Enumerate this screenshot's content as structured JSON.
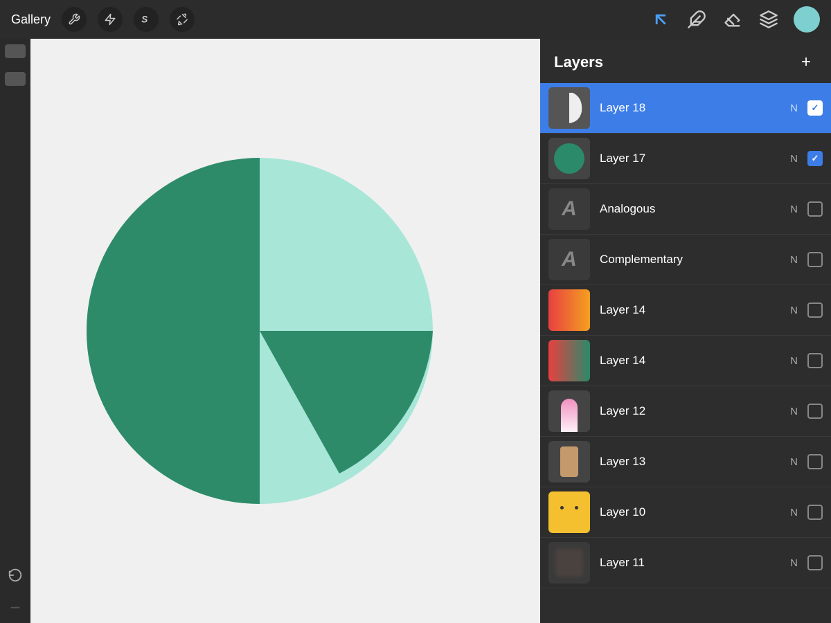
{
  "topbar": {
    "gallery_label": "Gallery",
    "tools": [
      "wrench",
      "lightning",
      "s-curve",
      "send"
    ],
    "right_tools": [
      "pen",
      "nib",
      "eraser",
      "layers"
    ],
    "avatar_color": "#7ecfcf"
  },
  "left_toolbar": {
    "top_buttons": [
      "rect1",
      "rect2"
    ],
    "undo_label": "↩"
  },
  "canvas": {
    "background": "#f0f0f0"
  },
  "layers_panel": {
    "title": "Layers",
    "add_label": "+",
    "layers": [
      {
        "id": 0,
        "name": "Layer 18",
        "mode": "N",
        "checked": true,
        "active": true,
        "thumb": "white-shape"
      },
      {
        "id": 1,
        "name": "Layer 17",
        "mode": "N",
        "checked": true,
        "active": false,
        "thumb": "green-circle"
      },
      {
        "id": 2,
        "name": "Analogous",
        "mode": "N",
        "checked": false,
        "active": false,
        "thumb": "letter"
      },
      {
        "id": 3,
        "name": "Complementary",
        "mode": "N",
        "checked": false,
        "active": false,
        "thumb": "letter"
      },
      {
        "id": 4,
        "name": "Layer 14",
        "mode": "N",
        "checked": false,
        "active": false,
        "thumb": "gradient-red"
      },
      {
        "id": 5,
        "name": "Layer 14",
        "mode": "N",
        "checked": false,
        "active": false,
        "thumb": "gradient-mixed"
      },
      {
        "id": 6,
        "name": "Layer 12",
        "mode": "N",
        "checked": false,
        "active": false,
        "thumb": "pink"
      },
      {
        "id": 7,
        "name": "Layer 13",
        "mode": "N",
        "checked": false,
        "active": false,
        "thumb": "brown"
      },
      {
        "id": 8,
        "name": "Layer 10",
        "mode": "N",
        "checked": false,
        "active": false,
        "thumb": "character"
      },
      {
        "id": 9,
        "name": "Layer 11",
        "mode": "N",
        "checked": false,
        "active": false,
        "thumb": "dark-blur"
      }
    ]
  }
}
